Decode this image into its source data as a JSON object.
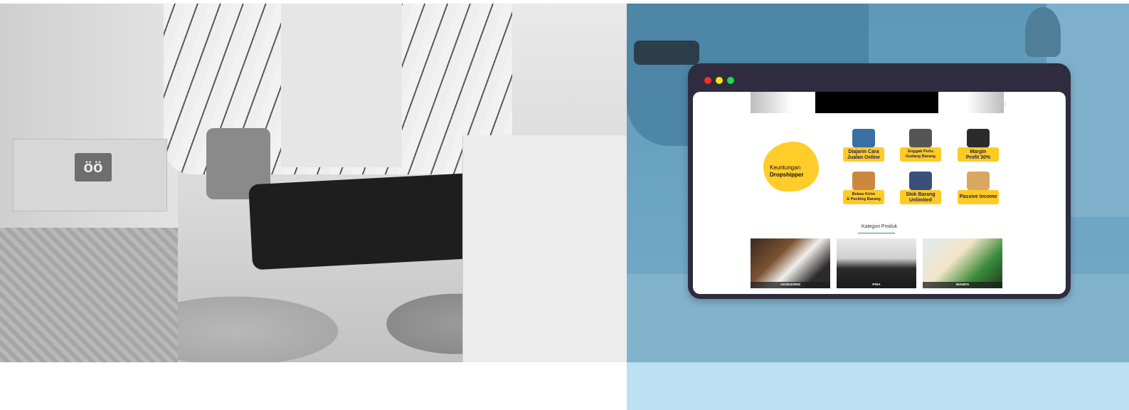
{
  "browser": {
    "window_dots": [
      "red",
      "yellow",
      "green"
    ],
    "dot_colors": {
      "red": "#ff2a2a",
      "yellow": "#ffe20a",
      "green": "#21d94a"
    },
    "frame_color": "#2e2c3e"
  },
  "website": {
    "keuntungan": {
      "line1": "Keuntungan",
      "line2": "Dropshipper",
      "accent": "#ffcd2a"
    },
    "benefits": [
      {
        "line1": "Diajarin Cara",
        "line2": "Jualan Online",
        "icon": "laptop-icon"
      },
      {
        "line1": "Enggak Perlu",
        "line2": "Gudang Barang",
        "icon": "monitor-icon"
      },
      {
        "line1": "Margin",
        "line2": "Profit 30%",
        "icon": "profit-chart-icon"
      },
      {
        "line1": "Bebas Kirim",
        "line2": "& Packing Barang",
        "icon": "courier-icon"
      },
      {
        "line1": "Stok Barang",
        "line2": "Unlimited",
        "icon": "boxes-icon"
      },
      {
        "line1": "Passive Income",
        "line2": "",
        "icon": "relax-person-icon"
      }
    ],
    "kategori": {
      "title": "Kategori Produk",
      "items": [
        "AKSESORIS",
        "PRIA",
        "WANITA"
      ]
    }
  },
  "colors": {
    "overlay_blue": "#6aa2c2",
    "bottom_band": "#bde0f2"
  }
}
